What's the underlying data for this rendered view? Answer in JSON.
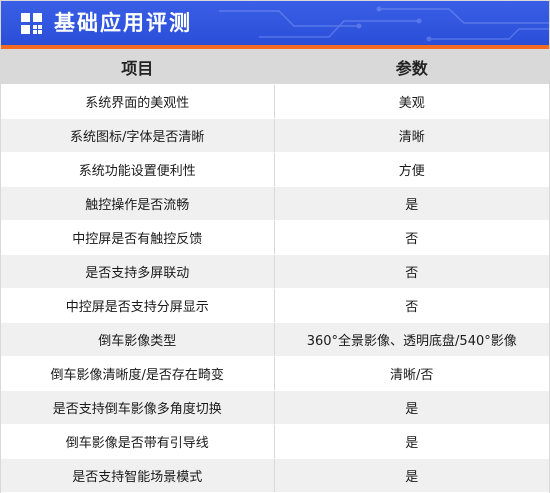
{
  "header": {
    "title": "基础应用评测",
    "icon": "grid-squares-icon",
    "colors": {
      "bar": "#2a4ed8",
      "accent": "#f26b21"
    }
  },
  "table": {
    "columns": [
      "项目",
      "参数"
    ],
    "rows": [
      [
        "系统界面的美观性",
        "美观"
      ],
      [
        "系统图标/字体是否清晰",
        "清晰"
      ],
      [
        "系统功能设置便利性",
        "方便"
      ],
      [
        "触控操作是否流畅",
        "是"
      ],
      [
        "中控屏是否有触控反馈",
        "否"
      ],
      [
        "是否支持多屏联动",
        "否"
      ],
      [
        "中控屏是否支持分屏显示",
        "否"
      ],
      [
        "倒车影像类型",
        "360°全景影像、透明底盘/540°影像"
      ],
      [
        "倒车影像清晰度/是否存在畸变",
        "清晰/否"
      ],
      [
        "是否支持倒车影像多角度切换",
        "是"
      ],
      [
        "倒车影像是否带有引导线",
        "是"
      ],
      [
        "是否支持智能场景模式",
        "是"
      ]
    ]
  }
}
